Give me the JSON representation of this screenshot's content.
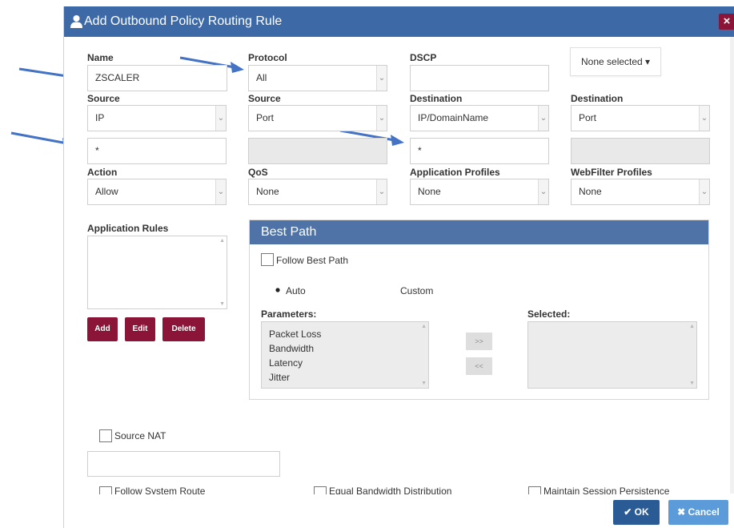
{
  "dialog": {
    "title": "Add Outbound Policy Routing Rule",
    "close_label": "×"
  },
  "labels": {
    "name": "Name",
    "protocol": "Protocol",
    "dscp": "DSCP",
    "source": "Source",
    "source2": "Source",
    "destination": "Destination",
    "destination2": "Destination",
    "action": "Action",
    "qos": "QoS",
    "application_profiles": "Application Profiles",
    "webfilter_profiles": "WebFilter Profiles",
    "application_rules": "Application Rules"
  },
  "fields": {
    "name_value": "ZSCALER",
    "protocol_value": "All",
    "dscp_value": "",
    "multiselect_label": "None selected ▾",
    "source_type": "IP",
    "source_port_type": "Port",
    "destination_type": "IP/DomainName",
    "destination_port_type": "Port",
    "source_ip_value": "*",
    "source_port_value": "",
    "destination_ip_value": "*",
    "destination_port_value": "",
    "action_value": "Allow",
    "qos_value": "None",
    "app_profile_value": "None",
    "webfilter_value": "None"
  },
  "rule_buttons": {
    "add": "Add",
    "edit": "Edit",
    "delete": "Delete"
  },
  "best_path": {
    "header": "Best Path",
    "follow_label": "Follow Best Path",
    "auto_label": "Auto",
    "custom_label": "Custom",
    "parameters_label": "Parameters:",
    "selected_label": "Selected:",
    "parameters": [
      "Packet Loss",
      "Bandwidth",
      "Latency",
      "Jitter"
    ],
    "add_arrow": ">>",
    "remove_arrow": "<<"
  },
  "source_nat": {
    "label": "Source NAT"
  },
  "cut_row": {
    "follow_system_route": "Follow System Route",
    "equal_bandwidth": "Equal Bandwidth Distribution",
    "maintain_session": "Maintain Session Persistence"
  },
  "footer": {
    "ok": "✔ OK",
    "cancel": "✖ Cancel"
  },
  "colors": {
    "titlebar": "#3d6aa7",
    "accent_button": "#8b1538",
    "ok_button": "#2b5b94",
    "cancel_button": "#5b9bd9",
    "annotation_arrow": "#4472c4"
  }
}
